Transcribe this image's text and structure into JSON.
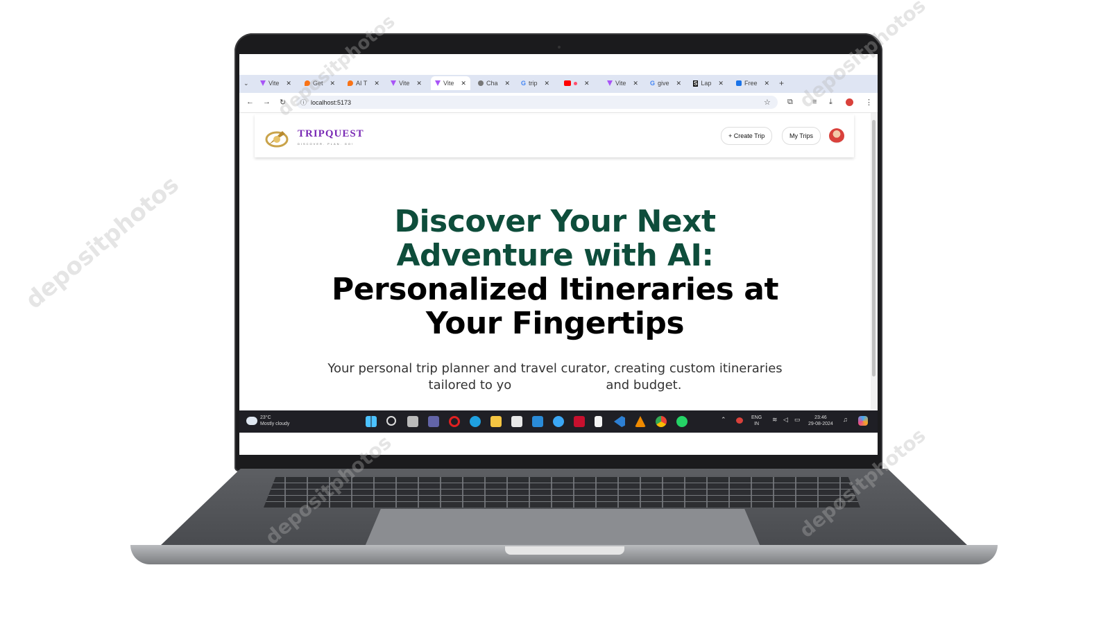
{
  "browser": {
    "tabs": [
      {
        "label": "Vite",
        "icon": "vite-icon",
        "color": "#a855f7"
      },
      {
        "label": "Get",
        "icon": "flame-icon",
        "color": "#f97316"
      },
      {
        "label": "AI T",
        "icon": "flame-icon",
        "color": "#f97316"
      },
      {
        "label": "Vite",
        "icon": "vite-icon",
        "color": "#a855f7"
      },
      {
        "label": "Vite",
        "icon": "vite-icon",
        "color": "#a855f7",
        "active": true
      },
      {
        "label": "Cha",
        "icon": "chat-icon",
        "color": "#555555"
      },
      {
        "label": "trip",
        "icon": "google-icon",
        "color": "#4285f4"
      },
      {
        "label": "",
        "icon": "youtube-icon",
        "color": "#ff0000"
      },
      {
        "label": "Vite",
        "icon": "vite-icon",
        "color": "#a855f7"
      },
      {
        "label": "give",
        "icon": "google-icon",
        "color": "#4285f4"
      },
      {
        "label": "Lap",
        "icon": "stock-icon",
        "color": "#111111"
      },
      {
        "label": "Free",
        "icon": "photo-icon",
        "color": "#1a73e8"
      }
    ],
    "new_tab_symbol": "+",
    "url": "localhost:5173"
  },
  "app": {
    "logo_text": "TRIPQUEST",
    "logo_tagline": "DISCOVER. PLAN. GO!",
    "create_trip_label": "+ Create Trip",
    "my_trips_label": "My Trips",
    "headline_green_1": "Discover Your Next",
    "headline_green_2": "Adventure with AI:",
    "headline_black_1": "Personalized Itineraries at",
    "headline_black_2": "Your Fingertips",
    "subtitle_line_1": "Your personal trip planner and travel curator, creating custom itineraries",
    "subtitle_line_2": "tailored to yo",
    "subtitle_line_2_end": "and budget.",
    "colors": {
      "headline_green": "#0e4d3b",
      "logo_purple": "#7a2bb5"
    }
  },
  "taskbar": {
    "weather_temp": "23°C",
    "weather_desc": "Mostly cloudy",
    "lang_1": "ENG",
    "lang_2": "IN",
    "time": "23:46",
    "date": "29-08-2024"
  },
  "watermark": "depositphotos"
}
